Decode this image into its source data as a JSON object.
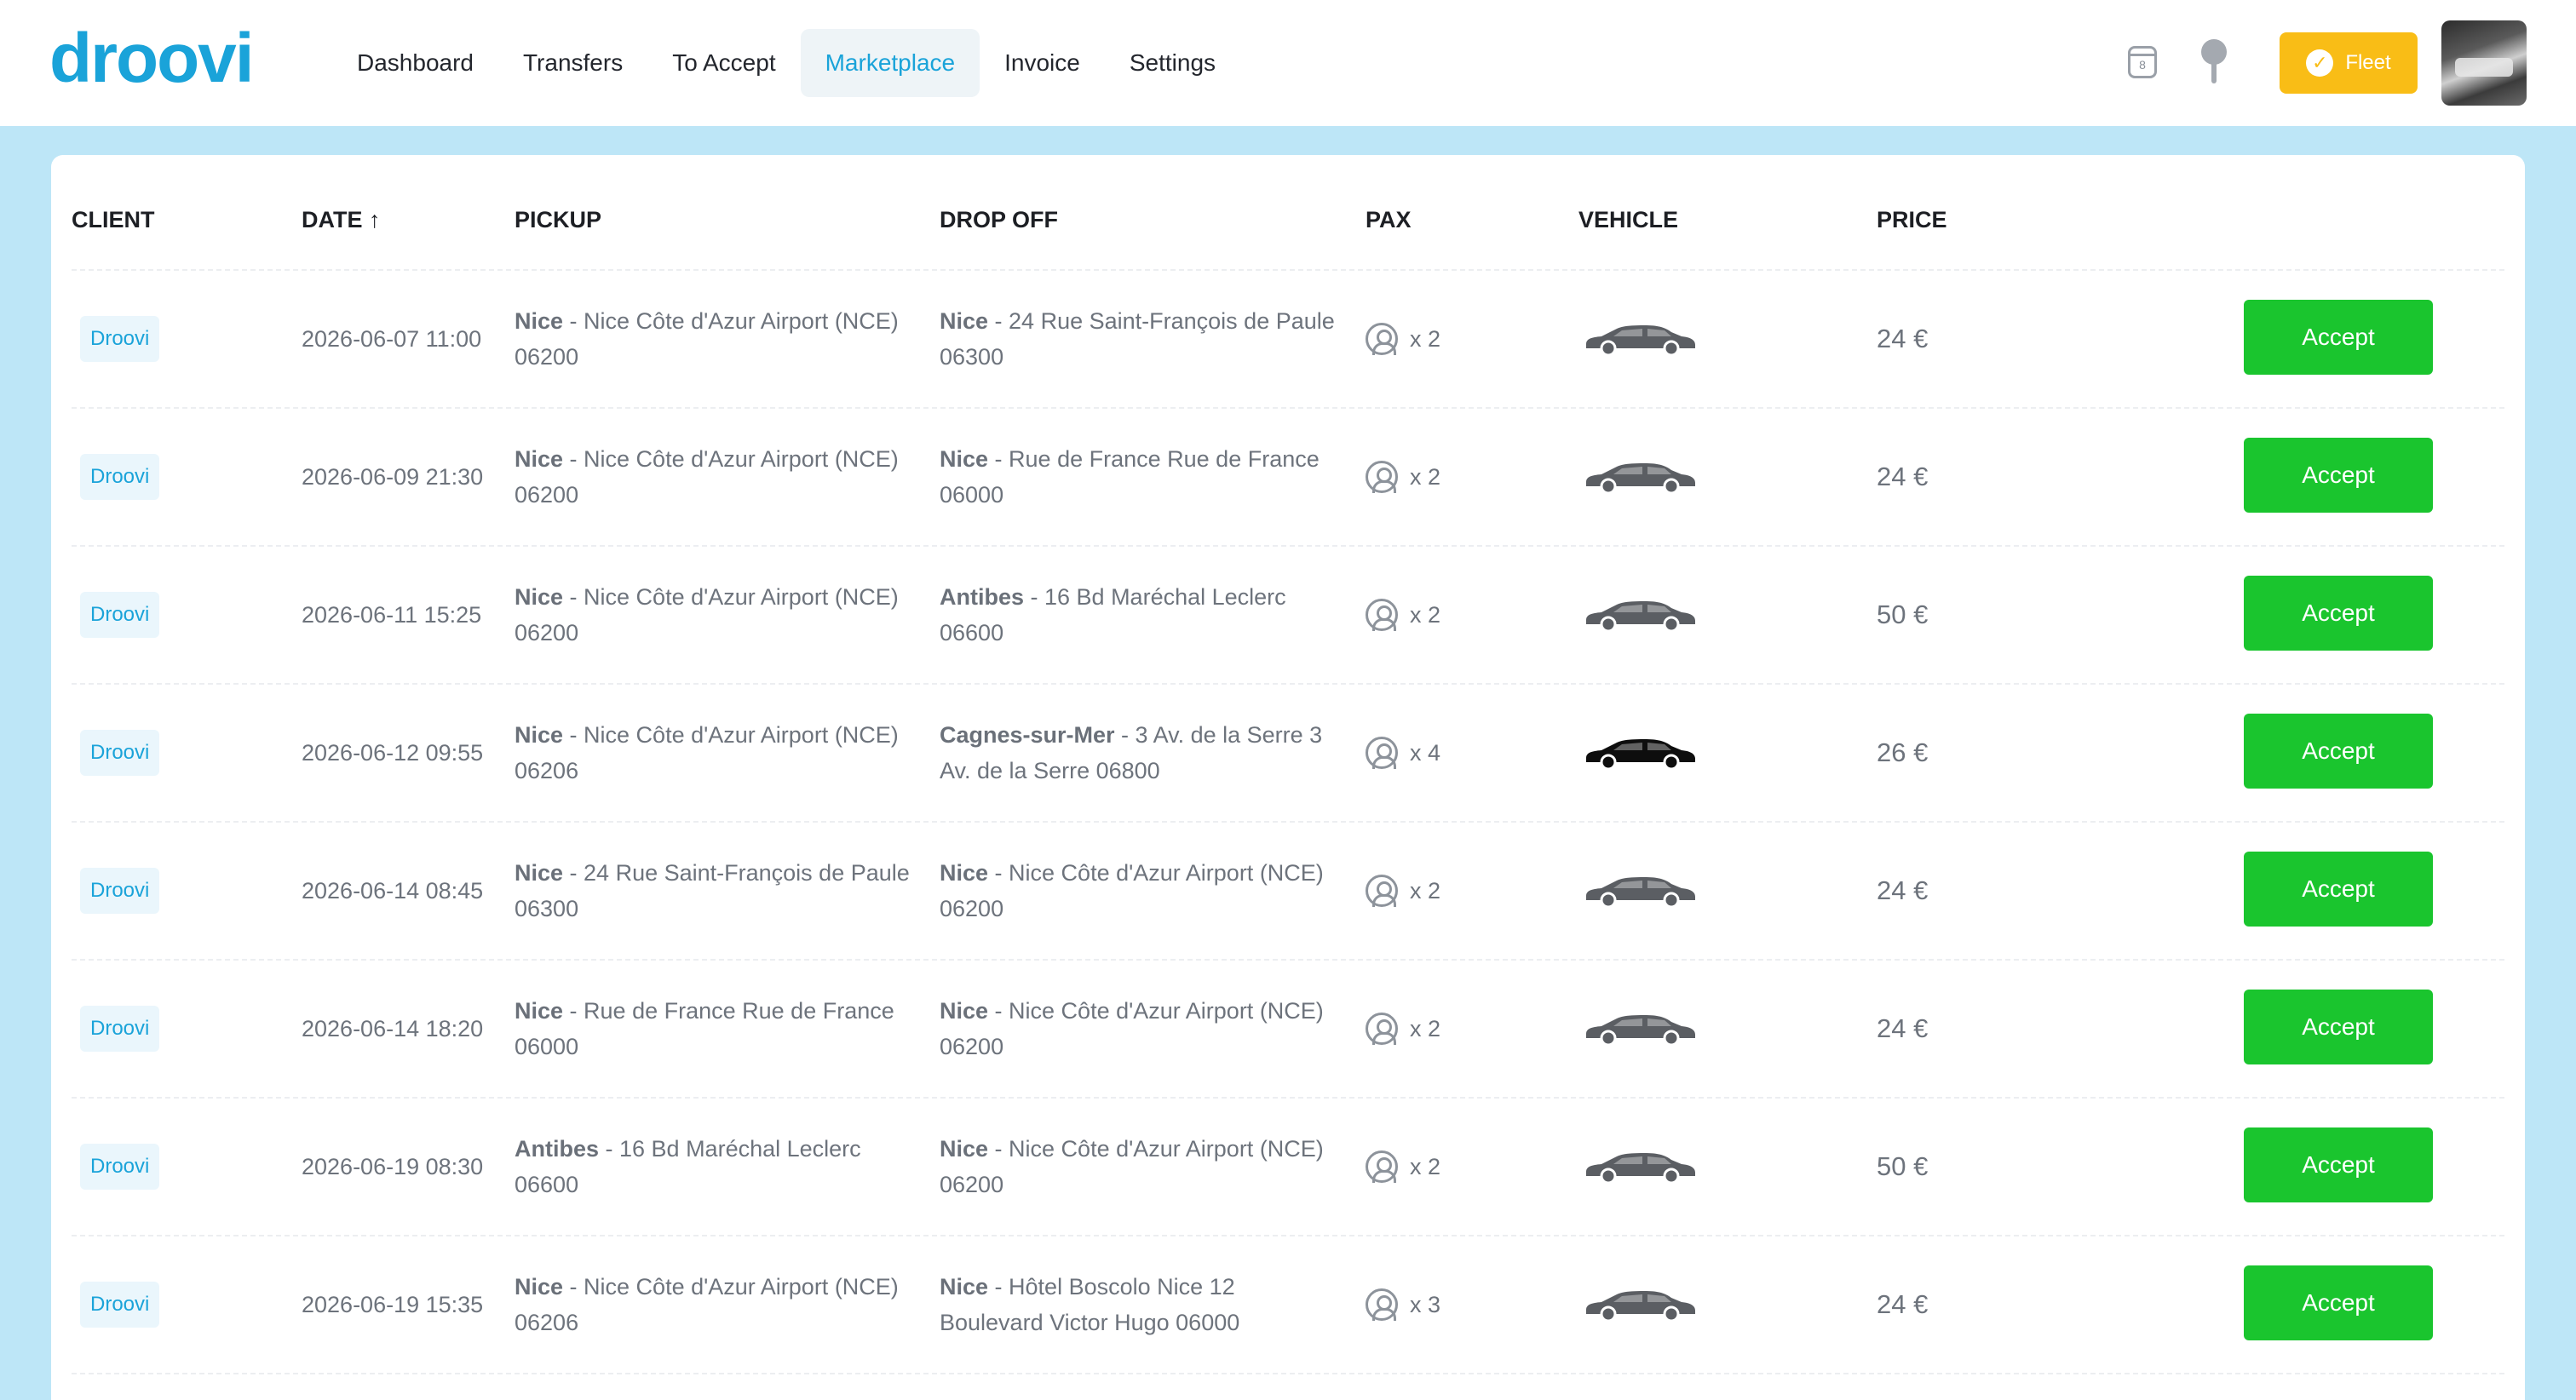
{
  "brand": {
    "logo_text": "droovi",
    "accent": "#1aa3d9"
  },
  "nav": {
    "items": [
      {
        "label": "Dashboard",
        "active": false
      },
      {
        "label": "Transfers",
        "active": false
      },
      {
        "label": "To Accept",
        "active": false
      },
      {
        "label": "Marketplace",
        "active": true
      },
      {
        "label": "Invoice",
        "active": false
      },
      {
        "label": "Settings",
        "active": false
      }
    ]
  },
  "header_right": {
    "calendar_icon": "calendar-icon",
    "calendar_day": "8",
    "pin_icon": "map-pin-icon",
    "fleet_label": "Fleet",
    "fleet_color": "#f9bd16",
    "avatar_icon": "user-avatar"
  },
  "table": {
    "columns": [
      "CLIENT",
      "DATE ↑",
      "PICKUP",
      "DROP OFF",
      "PAX",
      "VEHICLE",
      "PRICE"
    ],
    "accept_label": "Accept",
    "accept_color": "#1ac52e",
    "rows": [
      {
        "client": "Droovi",
        "date": "2026-06-07 11:00",
        "pickup_city": "Nice",
        "pickup_addr": " - Nice Côte d'Azur Airport (NCE) 06200",
        "drop_city": "Nice",
        "drop_addr": " - 24 Rue Saint-François de Paule 06300",
        "pax": "x 2",
        "vehicle": "sedan-grey",
        "price": "24 €"
      },
      {
        "client": "Droovi",
        "date": "2026-06-09 21:30",
        "pickup_city": "Nice",
        "pickup_addr": " - Nice Côte d'Azur Airport (NCE) 06200",
        "drop_city": "Nice",
        "drop_addr": " - Rue de France Rue de France 06000",
        "pax": "x 2",
        "vehicle": "sedan-grey",
        "price": "24 €"
      },
      {
        "client": "Droovi",
        "date": "2026-06-11 15:25",
        "pickup_city": "Nice",
        "pickup_addr": " - Nice Côte d'Azur Airport (NCE) 06200",
        "drop_city": "Antibes",
        "drop_addr": " - 16 Bd Maréchal Leclerc 06600",
        "pax": "x 2",
        "vehicle": "sedan-grey",
        "price": "50 €"
      },
      {
        "client": "Droovi",
        "date": "2026-06-12 09:55",
        "pickup_city": "Nice",
        "pickup_addr": " - Nice Côte d'Azur Airport (NCE) 06206",
        "drop_city": "Cagnes-sur-Mer",
        "drop_addr": " - 3 Av. de la Serre 3 Av. de la Serre 06800",
        "pax": "x 4",
        "vehicle": "sedan-black",
        "price": "26 €"
      },
      {
        "client": "Droovi",
        "date": "2026-06-14 08:45",
        "pickup_city": "Nice",
        "pickup_addr": " - 24 Rue Saint-François de Paule 06300",
        "drop_city": "Nice",
        "drop_addr": " - Nice Côte d'Azur Airport (NCE) 06200",
        "pax": "x 2",
        "vehicle": "sedan-grey",
        "price": "24 €"
      },
      {
        "client": "Droovi",
        "date": "2026-06-14 18:20",
        "pickup_city": "Nice",
        "pickup_addr": " - Rue de France Rue de France 06000",
        "drop_city": "Nice",
        "drop_addr": " - Nice Côte d'Azur Airport (NCE) 06200",
        "pax": "x 2",
        "vehicle": "sedan-grey",
        "price": "24 €"
      },
      {
        "client": "Droovi",
        "date": "2026-06-19 08:30",
        "pickup_city": "Antibes",
        "pickup_addr": " - 16 Bd Maréchal Leclerc 06600",
        "drop_city": "Nice",
        "drop_addr": " - Nice Côte d'Azur Airport (NCE) 06200",
        "pax": "x 2",
        "vehicle": "sedan-grey",
        "price": "50 €"
      },
      {
        "client": "Droovi",
        "date": "2026-06-19 15:35",
        "pickup_city": "Nice",
        "pickup_addr": " - Nice Côte d'Azur Airport (NCE) 06206",
        "drop_city": "Nice",
        "drop_addr": " - Hôtel Boscolo Nice 12 Boulevard Victor Hugo 06000",
        "pax": "x 3",
        "vehicle": "sedan-grey",
        "price": "24 €"
      }
    ]
  }
}
